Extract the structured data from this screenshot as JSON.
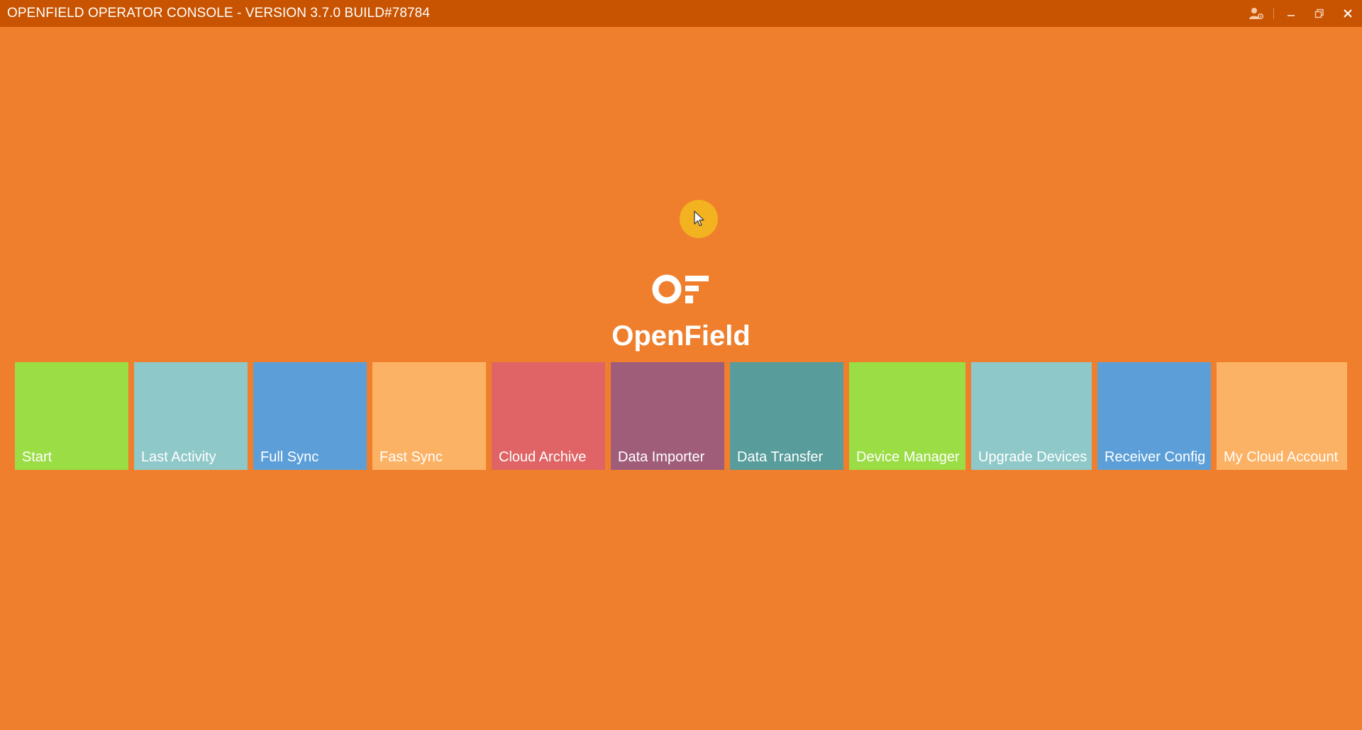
{
  "window": {
    "title": "OPENFIELD OPERATOR CONSOLE - VERSION 3.7.0 BUILD#78784",
    "controls": {
      "user": "user-settings-icon",
      "minimize": "minimize-icon",
      "restore": "restore-icon",
      "close": "close-icon"
    }
  },
  "brand": {
    "name": "OpenField",
    "logo_icon": "openfield-logo-icon"
  },
  "tiles": [
    {
      "label": "Start",
      "color": "#9ADD45"
    },
    {
      "label": "Last Activity",
      "color": "#8FC8C8"
    },
    {
      "label": "Full Sync",
      "color": "#5C9FD8"
    },
    {
      "label": "Fast Sync",
      "color": "#FCB265"
    },
    {
      "label": "Cloud Archive",
      "color": "#E06465"
    },
    {
      "label": "Data Importer",
      "color": "#A05D7A"
    },
    {
      "label": "Data Transfer",
      "color": "#589C9C"
    },
    {
      "label": "Device Manager",
      "color": "#9ADD45"
    },
    {
      "label": "Upgrade Devices",
      "color": "#8FC8C8"
    },
    {
      "label": "Receiver Config",
      "color": "#5C9FD8"
    },
    {
      "label": "My Cloud Account",
      "color": "#FCB265"
    }
  ],
  "colors": {
    "background": "#F07F2D",
    "titlebar": "#C85300",
    "cursor_highlight": "#F3B21F"
  }
}
